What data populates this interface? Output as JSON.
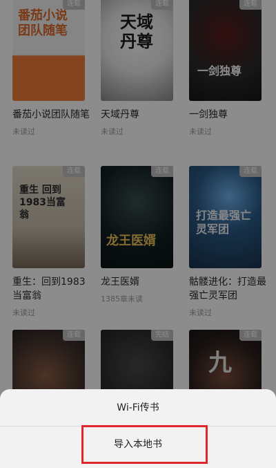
{
  "books": [
    {
      "title": "番茄小说团队随笔",
      "badge": "连载",
      "status": "未读过",
      "cover_text": "番茄小说团队随笔",
      "cover_colors": [
        "#f3f3f3",
        "#ee7d3a"
      ]
    },
    {
      "title": "天域丹尊",
      "badge": "连载",
      "status": "未读过",
      "cover_text": "天域丹尊",
      "cover_colors": [
        "#f5f5f5",
        "#3c3c3c"
      ]
    },
    {
      "title": "一剑独尊",
      "badge": "连载",
      "status": "未读过",
      "cover_text": "一剑独尊",
      "cover_colors": [
        "#2b2b2b",
        "#c43c31"
      ]
    },
    {
      "title": "重生：回到1983当富翁",
      "badge": "连载",
      "status": "未读过",
      "cover_text": "重生 回到1983当富翁",
      "cover_colors": [
        "#dcd6c8",
        "#7b6b5a"
      ]
    },
    {
      "title": "龙王医婿",
      "badge": "连载",
      "status": "1385章未读",
      "cover_text": "龙王医婿",
      "cover_colors": [
        "#0d1a1e",
        "#e2b44c"
      ]
    },
    {
      "title": "骷髅进化：打造最强亡灵军团",
      "badge": "连载",
      "status": "未读过",
      "cover_text": "打造最强亡灵军团",
      "cover_colors": [
        "#18324c",
        "#2c5c88"
      ]
    },
    {
      "title": "",
      "badge": "连载",
      "status": "",
      "cover_text": "",
      "cover_colors": [
        "#3b2f2a",
        "#7a4d3a"
      ]
    },
    {
      "title": "",
      "badge": "完结",
      "status": "",
      "cover_text": "",
      "cover_colors": [
        "#2b2b2b",
        "#141414"
      ]
    },
    {
      "title": "",
      "badge": "连载",
      "status": "",
      "cover_text": "九",
      "cover_colors": [
        "#151515",
        "#5a3d35"
      ]
    }
  ],
  "sheet": {
    "wifi_label": "Wi-Fi传书",
    "import_label": "导入本地书"
  },
  "colors": {
    "highlight": "#e0262a",
    "status": "#9b9b9b",
    "badge": "#bfbfbf"
  }
}
